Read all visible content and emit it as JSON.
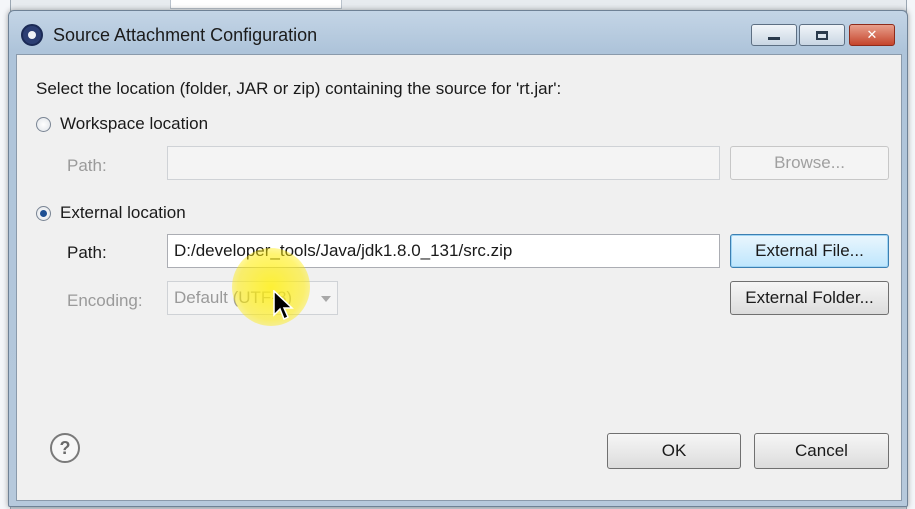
{
  "dialog": {
    "title": "Source Attachment Configuration",
    "prompt": "Select the location (folder, JAR or zip) containing the source for 'rt.jar':",
    "workspace": {
      "radio_label": "Workspace location",
      "selected": false,
      "path_label": "Path:",
      "path_value": "",
      "browse_label": "Browse..."
    },
    "external": {
      "radio_label": "External location",
      "selected": true,
      "path_label": "Path:",
      "path_value": "D:/developer_tools/Java/jdk1.8.0_131/src.zip",
      "encoding_label": "Encoding:",
      "encoding_value": "Default (UTF-8)",
      "external_file_label": "External File...",
      "external_folder_label": "External Folder..."
    },
    "help_glyph": "?",
    "ok_label": "OK",
    "cancel_label": "Cancel",
    "window_controls": {
      "minimize": "minimize-icon",
      "maximize": "maximize-icon",
      "close": "close-icon"
    },
    "colors": {
      "title_bar": "#b6c9dc",
      "focus_button": "#bee6fd",
      "cursor_highlight": "#ffeb00"
    }
  }
}
